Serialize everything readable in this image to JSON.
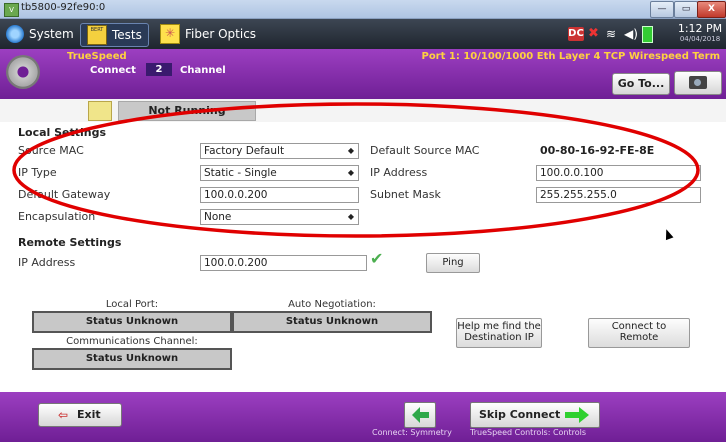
{
  "window": {
    "title": "tb5800-92fe90:0",
    "min": "—",
    "max": "▭",
    "close": "X"
  },
  "toolbar": {
    "system_label": "System",
    "tests_label": "Tests",
    "tests_badge": "BERT",
    "fiber_label": "Fiber Optics",
    "status_dc": "DC",
    "time": "1:12 PM",
    "date": "04/04/2018"
  },
  "banner": {
    "app_name": "TrueSpeed",
    "connect_label": "Connect",
    "channel_num": "2",
    "channel_label": "Channel",
    "port_info": "Port 1: 10/100/1000 Eth Layer 4 TCP Wirespeed Term",
    "goto_label": "Go To..."
  },
  "run": {
    "status": "Not Running"
  },
  "local": {
    "heading": "Local Settings",
    "source_mac_label": "Source MAC",
    "source_mac_value": "Factory Default",
    "default_source_mac_label": "Default Source MAC",
    "default_source_mac_value": "00-80-16-92-FE-8E",
    "ip_type_label": "IP Type",
    "ip_type_value": "Static - Single",
    "ip_address_label": "IP Address",
    "ip_address_value": "100.0.0.100",
    "gateway_label": "Default Gateway",
    "gateway_value": "100.0.0.200",
    "subnet_label": "Subnet Mask",
    "subnet_value": "255.255.255.0",
    "encap_label": "Encapsulation",
    "encap_value": "None"
  },
  "remote": {
    "heading": "Remote Settings",
    "ip_label": "IP Address",
    "ip_value": "100.0.0.200",
    "ping_label": "Ping"
  },
  "status": {
    "local_port_label": "Local Port:",
    "local_port_value": "Status Unknown",
    "autoneg_label": "Auto Negotiation:",
    "autoneg_value": "Status Unknown",
    "comm_label": "Communications Channel:",
    "comm_value": "Status Unknown",
    "help_label": "Help me find the Destination IP",
    "connect_label": "Connect to Remote"
  },
  "bottom": {
    "exit_label": "Exit",
    "skip_label": "Skip Connect",
    "caption_left": "Connect: Symmetry",
    "caption_right": "TrueSpeed Controls: Controls"
  },
  "colors": {
    "banner": "#8a2fb3",
    "accent_yellow": "#ffd23f",
    "annotation": "#e00000",
    "check": "#4caf50"
  }
}
